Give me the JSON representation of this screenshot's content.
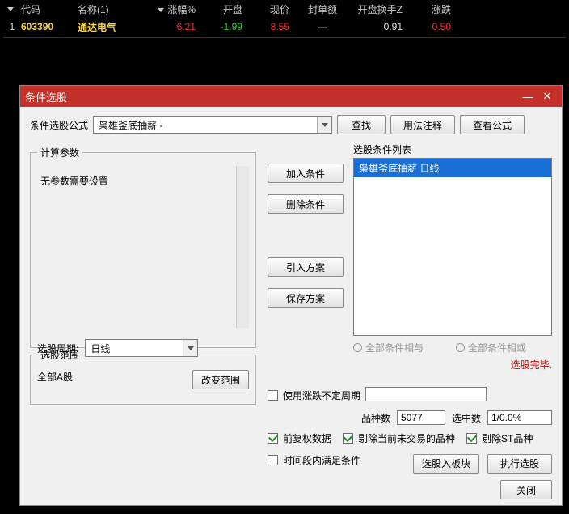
{
  "stock_table": {
    "headers": {
      "code": "代码",
      "name": "名称(1)",
      "pct": "涨幅%",
      "open": "开盘",
      "price": "现价",
      "seal": "封单额",
      "turn": "开盘换手Z",
      "chg": "涨跌"
    },
    "row": {
      "idx": "1",
      "code": "603390",
      "name": "通达电气",
      "pct": "6.21",
      "open": "-1.99",
      "price": "8.55",
      "seal": "—",
      "turn": "0.91",
      "chg": "0.50"
    }
  },
  "dialog": {
    "title": "条件选股",
    "formula_label": "条件选股公式",
    "formula_value": "枭雄釜底抽薪 -",
    "btn_find": "查找",
    "btn_usage": "用法注释",
    "btn_view_formula": "查看公式",
    "params_legend": "计算参数",
    "params_text": "无参数需要设置",
    "period_label": "选股周期:",
    "period_value": "日线",
    "scope_legend": "选股范围",
    "scope_text": "全部A股",
    "btn_change_scope": "改变范围",
    "btn_add_cond": "加入条件",
    "btn_del_cond": "删除条件",
    "btn_import_plan": "引入方案",
    "btn_save_plan": "保存方案",
    "cond_list_label": "选股条件列表",
    "cond_item": "枭雄釜底抽薪  日线",
    "radio_and": "全部条件相与",
    "radio_or": "全部条件相或",
    "done_text": "选股完毕.",
    "chk_use_period": "使用涨跌不定周期",
    "count_label": "品种数",
    "count_value": "5077",
    "hit_label": "选中数",
    "hit_value": "1/0.0%",
    "chk_fq": "前复权数据",
    "chk_remove_untraded": "剔除当前未交易的品种",
    "chk_remove_st": "剔除ST品种",
    "chk_time_range": "时间段内满足条件",
    "btn_to_block": "选股入板块",
    "btn_run": "执行选股",
    "btn_close": "关闭"
  }
}
